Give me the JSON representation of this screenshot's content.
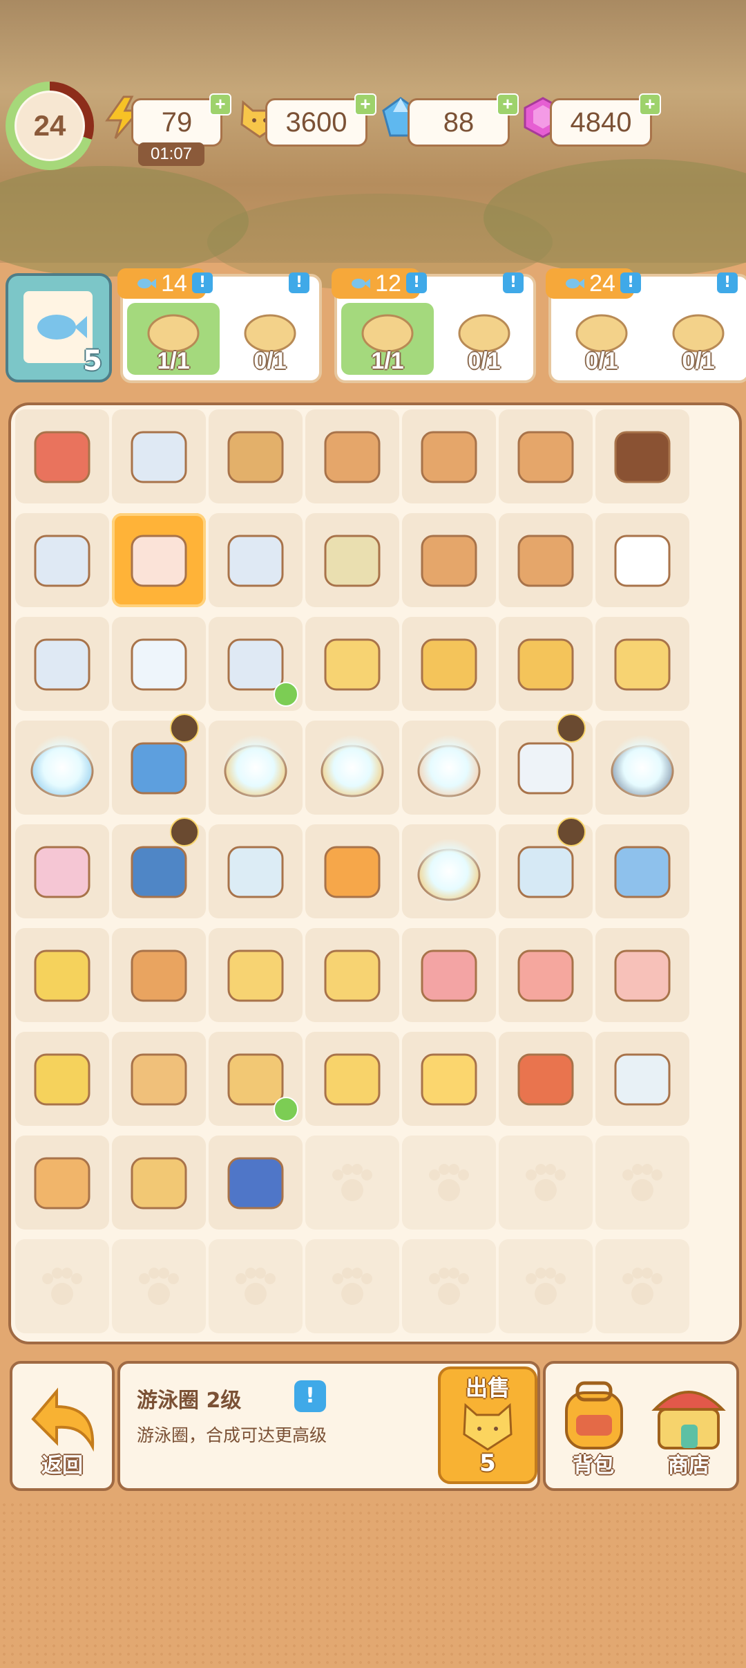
{
  "hud": {
    "level": "24",
    "energy": "79",
    "energy_timer": "01:07",
    "coins": "3600",
    "gems": "88",
    "crystals": "4840",
    "plus": "+"
  },
  "orders": {
    "book_count": "5",
    "list": [
      {
        "reward": "14",
        "slots": [
          {
            "count": "1/1",
            "done": true,
            "icon": "sandwich"
          },
          {
            "count": "0/1",
            "done": false,
            "icon": "lemon-bucket"
          }
        ]
      },
      {
        "reward": "12",
        "slots": [
          {
            "count": "1/1",
            "done": true,
            "icon": "ice-tray"
          },
          {
            "count": "0/1",
            "done": false,
            "icon": "cake-roll"
          }
        ]
      },
      {
        "reward": "24",
        "slots": [
          {
            "count": "0/1",
            "done": false,
            "icon": "juicer"
          },
          {
            "count": "0/1",
            "done": false,
            "icon": "lemonade-bucket"
          }
        ]
      }
    ],
    "excl": "!"
  },
  "board": {
    "rows": [
      [
        "tongs",
        "ice-tray",
        "roast-chicken",
        "book-stand",
        "book-box",
        "book-tray",
        "steak"
      ],
      [
        "ice-tray",
        "swim-ring",
        "ice-tray",
        "plate-spoon",
        "book-tray-small",
        "book-stand",
        "fried-egg"
      ],
      [
        "ice-tray",
        "ice-cubes",
        "ice-tray-done",
        "lemon-juice",
        "lemon-cake",
        "lemon-cake",
        "lemon-juice"
      ],
      [
        "bed-locked",
        "toaster",
        "plate-locked",
        "basket-locked",
        "box-locked",
        "fridge",
        "pan-locked"
      ],
      [
        "cupcake",
        "toaster-blue",
        "lunch-box",
        "orange-juice",
        "bag-locked",
        "cooler",
        "blue-book"
      ],
      [
        "lemon-plate",
        "cookie",
        "lemon-juice",
        "lemon-juice",
        "candy",
        "lollipop",
        "swirl-lollipop"
      ],
      [
        "lemon-plate",
        "toast",
        "sandwich",
        "milk-carton",
        "cup-drink",
        "jam-jar",
        "glass-cup"
      ],
      [
        "donut",
        "egg-toast",
        "butter-tray",
        "empty",
        "empty",
        "empty",
        "empty"
      ],
      [
        "empty",
        "empty",
        "empty",
        "empty",
        "empty",
        "empty",
        "empty"
      ]
    ]
  },
  "bottom": {
    "back_label": "返回",
    "item_title": "游泳圈 2级",
    "item_desc": "游泳圈，合成可达更高级",
    "sell_label": "出售",
    "sell_price": "5",
    "bag_label": "背包",
    "shop_label": "商店",
    "info_excl": "!"
  },
  "colors": {
    "accent": "#f8b233",
    "frame": "#a06a43",
    "done": "#a4d97d",
    "info": "#3fa9e8"
  }
}
